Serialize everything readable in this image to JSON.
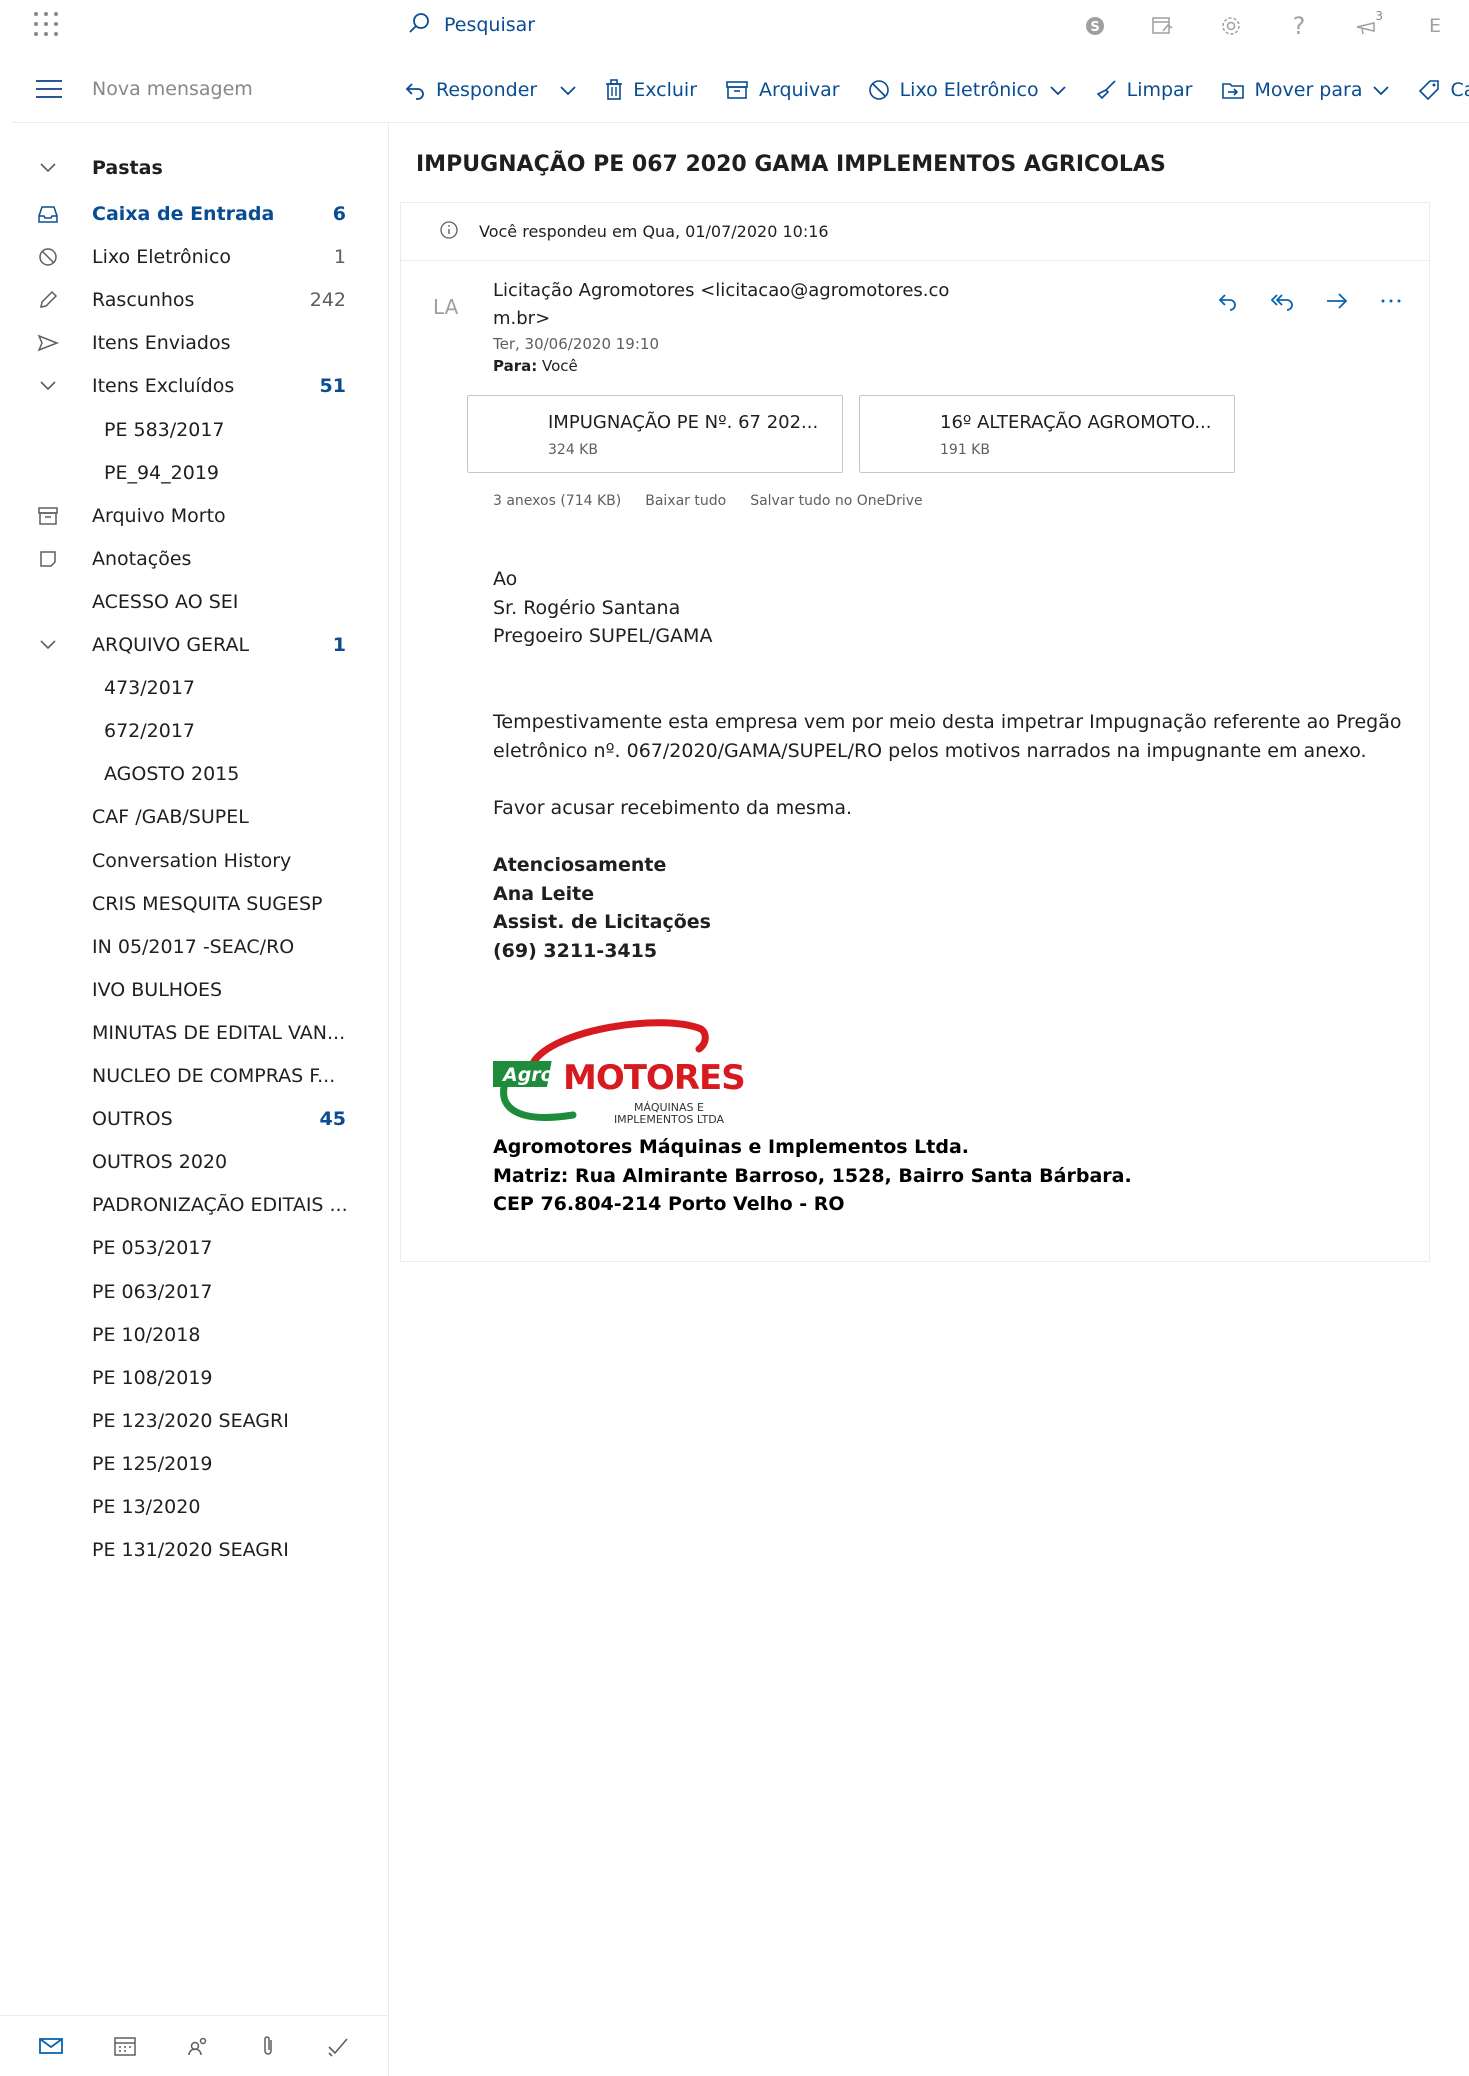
{
  "header": {
    "search_label": "Pesquisar",
    "notification_count": "3",
    "user_initial": "E"
  },
  "toolbar": {
    "new_message": "Nova mensagem",
    "reply": "Responder",
    "delete": "Excluir",
    "archive": "Arquivar",
    "junk": "Lixo Eletrônico",
    "sweep": "Limpar",
    "move_to": "Mover para",
    "categorize": "Ca"
  },
  "folders": {
    "header": "Pastas",
    "items": [
      {
        "label": "Caixa de Entrada",
        "count": "6"
      },
      {
        "label": "Lixo Eletrônico",
        "count": "1"
      },
      {
        "label": "Rascunhos",
        "count": "242"
      },
      {
        "label": "Itens Enviados",
        "count": ""
      },
      {
        "label": "Itens Excluídos",
        "count": "51"
      },
      {
        "label": "PE 583/2017",
        "count": ""
      },
      {
        "label": "PE_94_2019",
        "count": ""
      },
      {
        "label": "Arquivo Morto",
        "count": ""
      },
      {
        "label": "Anotações",
        "count": ""
      },
      {
        "label": "ACESSO AO SEI",
        "count": ""
      },
      {
        "label": "ARQUIVO GERAL",
        "count": "1"
      },
      {
        "label": "473/2017",
        "count": ""
      },
      {
        "label": "672/2017",
        "count": ""
      },
      {
        "label": "AGOSTO 2015",
        "count": ""
      },
      {
        "label": "CAF /GAB/SUPEL",
        "count": ""
      },
      {
        "label": "Conversation History",
        "count": ""
      },
      {
        "label": "CRIS MESQUITA SUGESP",
        "count": ""
      },
      {
        "label": "IN 05/2017 -SEAC/RO",
        "count": ""
      },
      {
        "label": "IVO BULHOES",
        "count": ""
      },
      {
        "label": "MINUTAS DE EDITAL VAN...",
        "count": ""
      },
      {
        "label": "NUCLEO DE COMPRAS F...",
        "count": ""
      },
      {
        "label": "OUTROS",
        "count": "45"
      },
      {
        "label": "OUTROS 2020",
        "count": ""
      },
      {
        "label": "PADRONIZAÇÃO EDITAIS ...",
        "count": ""
      },
      {
        "label": "PE 053/2017",
        "count": ""
      },
      {
        "label": "PE 063/2017",
        "count": ""
      },
      {
        "label": "PE 10/2018",
        "count": ""
      },
      {
        "label": "PE 108/2019",
        "count": ""
      },
      {
        "label": "PE 123/2020 SEAGRI",
        "count": ""
      },
      {
        "label": "PE 125/2019",
        "count": ""
      },
      {
        "label": "PE 13/2020",
        "count": ""
      },
      {
        "label": "PE 131/2020 SEAGRI",
        "count": ""
      }
    ]
  },
  "message": {
    "subject": "IMPUGNAÇÃO PE 067 2020 GAMA IMPLEMENTOS AGRICOLAS",
    "replied_info": "Você respondeu em Qua, 01/07/2020 10:16",
    "avatar_initials": "LA",
    "sender": "Licitação Agromotores <licitacao@agromotores.com.br>",
    "date": "Ter, 30/06/2020 19:10",
    "to_label": "Para:",
    "to_value": "Você",
    "attachments": [
      {
        "name": "IMPUGNAÇÃO PE Nº. 67 202...",
        "size": "324 KB"
      },
      {
        "name": "16º ALTERAÇÃO AGROMOTO...",
        "size": "191 KB"
      }
    ],
    "attach_summary": "3 anexos (714 KB)",
    "download_all": "Baixar tudo",
    "save_onedrive": "Salvar tudo no OneDrive",
    "body": {
      "greeting_1": "Ao",
      "greeting_2": "Sr. Rogério Santana",
      "greeting_3": "Pregoeiro SUPEL/GAMA",
      "paragraph": "Tempestivamente esta empresa vem por meio desta impetrar Impugnação referente ao Pregão eletrônico nº. 067/2020/GAMA/SUPEL/RO pelos motivos narrados na impugnante em anexo.",
      "request": "Favor acusar recebimento da mesma.",
      "sig_1": "Atenciosamente",
      "sig_2": "Ana Leite",
      "sig_3": "Assist. de Licitações",
      "sig_4": "(69) 3211-3415"
    },
    "logo": {
      "agro": "Agro",
      "motores": "MOTORES",
      "line1": "MÁQUINAS E",
      "line2": "IMPLEMENTOS LTDA"
    },
    "company": {
      "line_1": "Agromotores Máquinas e Implementos Ltda.",
      "line_2": "Matriz: Rua Almirante Barroso, 1528, Bairro Santa Bárbara.",
      "line_3": "CEP 76.804-214 Porto Velho - RO"
    }
  },
  "icons": {
    "accent": "#0a4c94",
    "logo_red": "#d71920",
    "logo_green": "#1e8c3a"
  }
}
